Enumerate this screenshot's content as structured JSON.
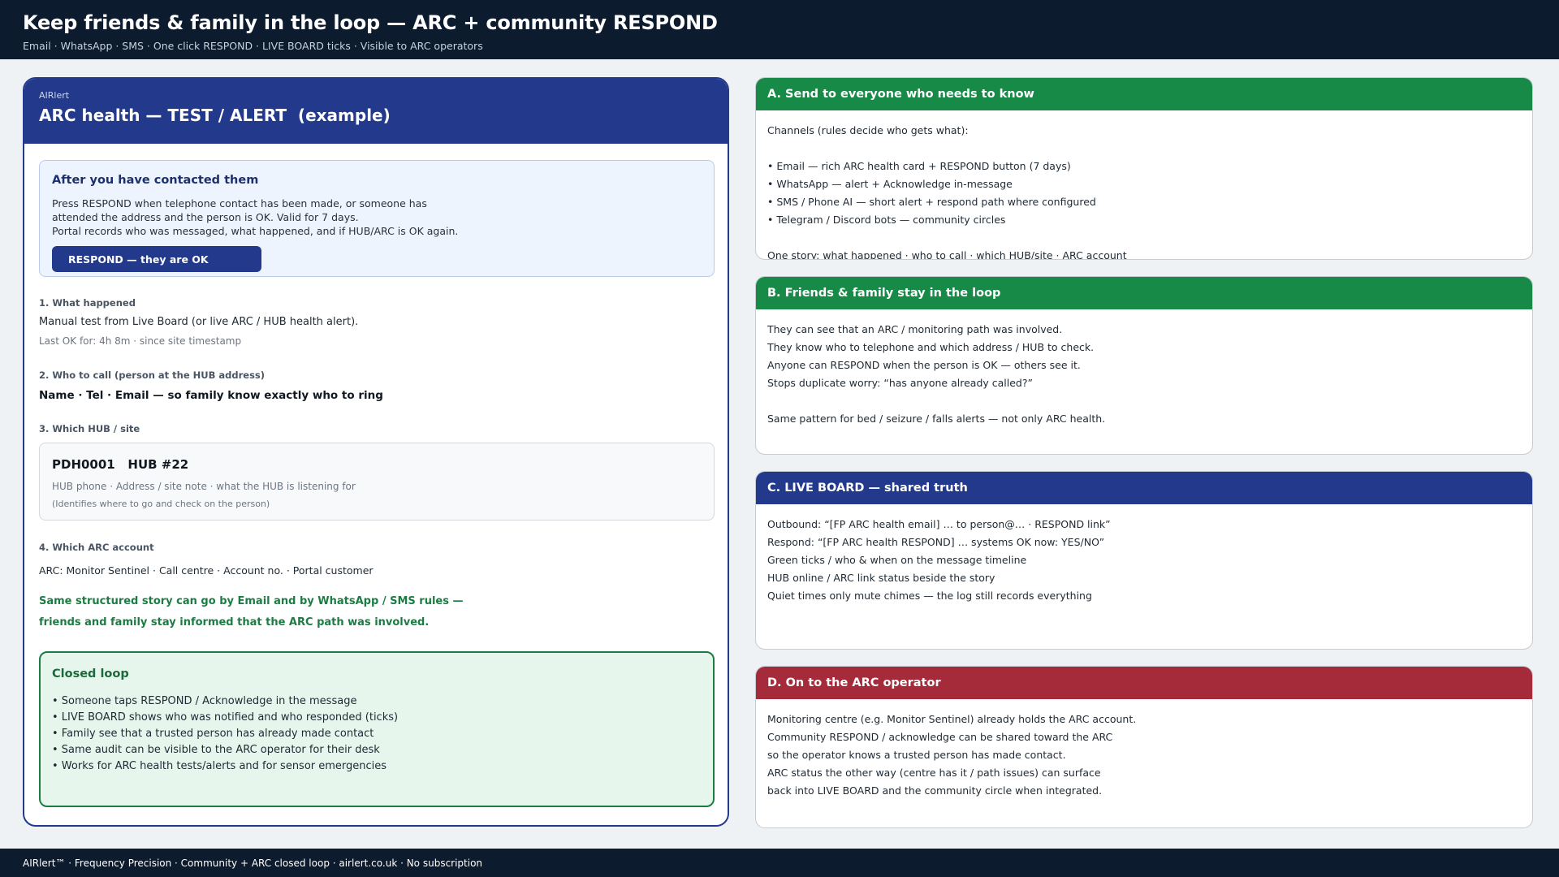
{
  "header": {
    "title": "Keep friends & family in the loop — ARC + community RESPOND",
    "subtitle": "Email · WhatsApp · SMS  ·  One click RESPOND  ·  LIVE BOARD ticks  ·  Visible to ARC operators"
  },
  "card": {
    "app_name": "AIRlert",
    "title": "ARC health — TEST / ALERT  (example)",
    "contact": {
      "title": "After you have contacted them",
      "lines": [
        "Press RESPOND when telephone contact has been made, or someone has",
        "attended the address and the person is OK. Valid for 7 days.",
        "Portal records who was messaged, what happened, and if HUB/ARC is OK again."
      ],
      "button_label": "RESPOND — they are OK"
    },
    "what_happened": {
      "heading": "1. What happened",
      "text": "Manual test from Live Board (or live ARC / HUB health alert).",
      "detail": "Last OK for: 4h 8m  ·  since site timestamp"
    },
    "who_to_call": {
      "heading": "2. Who to call  (person at the HUB address)",
      "text": "Name · Tel · Email — so family know exactly who to ring"
    },
    "hub": {
      "heading": "3. Which HUB / site",
      "title": "PDH0001   HUB #22",
      "line1": "HUB phone · Address / site note · what the HUB is listening for",
      "line2": "(Identifies where to go and check on the person)"
    },
    "arc": {
      "heading": "4. Which ARC account",
      "text": "ARC: Monitor Sentinel   ·   Call centre · Account no. · Portal customer"
    },
    "green_note": [
      "Same structured story can go by Email and by WhatsApp / SMS rules —",
      "friends and family stay informed that the ARC path was involved."
    ],
    "closed_loop": {
      "title": "Closed loop",
      "items": [
        "• Someone taps RESPOND / Acknowledge in the message",
        "• LIVE BOARD shows who was notified and who responded (ticks)",
        "• Family see that a trusted person has already made contact",
        "• Same audit can be visible to the ARC operator for their desk",
        "• Works for ARC health tests/alerts and for sensor emergencies"
      ]
    }
  },
  "panels": [
    {
      "title": "A. Send to everyone who needs to know",
      "color": "#178a47",
      "lines": [
        "Channels (rules decide who gets what):",
        "",
        "• Email — rich ARC health card + RESPOND button (7 days)",
        "• WhatsApp — alert + Acknowledge in-message",
        "• SMS / Phone AI — short alert + respond path where configured",
        "• Telegram / Discord bots — community circles",
        "",
        "One story: what happened · who to call · which HUB/site · ARC account"
      ]
    },
    {
      "title": "B. Friends & family stay in the loop",
      "color": "#178a47",
      "lines": [
        "They can see that an ARC / monitoring path was involved.",
        "They know who to telephone and which address / HUB to check.",
        "Anyone can RESPOND when the person is OK — others see it.",
        "Stops duplicate worry: “has anyone already called?”",
        "",
        "Same pattern for bed / seizure / falls alerts — not only ARC health."
      ]
    },
    {
      "title": "C. LIVE BOARD — shared truth",
      "color": "#22398c",
      "lines": [
        "Outbound: “[FP ARC health email] … to person@… · RESPOND link”",
        "Respond: “[FP ARC health RESPOND] … systems OK now: YES/NO”",
        "Green ticks / who & when on the message timeline",
        "HUB online / ARC link status beside the story",
        "Quiet times only mute chimes — the log still records everything"
      ]
    },
    {
      "title": "D. On to the ARC operator",
      "color": "#a52a3a",
      "lines": [
        "Monitoring centre (e.g. Monitor Sentinel) already holds the ARC account.",
        "Community RESPOND / acknowledge can be shared toward the ARC",
        "so the operator knows a trusted person has made contact.",
        "ARC status the other way (centre has it / path issues) can surface",
        "back into LIVE BOARD and the community circle when integrated."
      ]
    }
  ],
  "footer": {
    "text": "AIRlert™ · Frequency Precision · Community + ARC closed loop · airlert.co.uk · No subscription"
  }
}
